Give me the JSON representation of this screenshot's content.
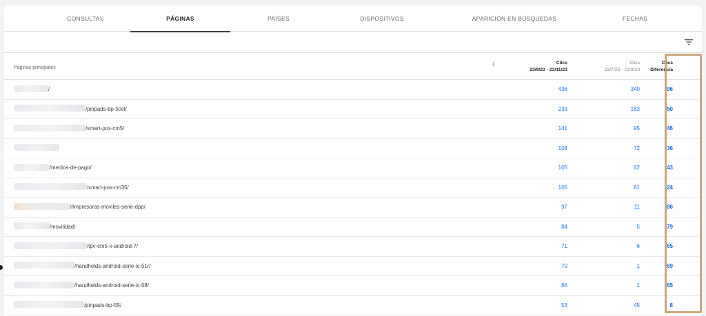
{
  "tabs": [
    {
      "label": "CONSULTAS"
    },
    {
      "label": "PÁGINAS"
    },
    {
      "label": "PAÍSES"
    },
    {
      "label": "DISPOSITIVOS"
    },
    {
      "label": "APARICIÓN EN BÚSQUEDAS"
    },
    {
      "label": "FECHAS"
    }
  ],
  "active_tab": "PÁGINAS",
  "table": {
    "page_header": "Páginas principales",
    "columns": [
      {
        "line1": "Clics",
        "line2": "23/9/23 - 23/11/23",
        "sort": "↓"
      },
      {
        "line1": "Clics",
        "line2": "23/7/23 - 22/9/23"
      },
      {
        "line1": "Clics",
        "line2": "Diferencia"
      }
    ],
    "rows": [
      {
        "path": "/",
        "c1": "436",
        "c2": "340",
        "diff": "96"
      },
      {
        "path": "/pinpads-bp-50cl/",
        "c1": "233",
        "c2": "183",
        "diff": "50"
      },
      {
        "path": "/smart-pos-cm5/",
        "c1": "141",
        "c2": "95",
        "diff": "46"
      },
      {
        "path": "",
        "c1": "108",
        "c2": "72",
        "diff": "36"
      },
      {
        "path": "/medios-de-pago/",
        "c1": "105",
        "c2": "62",
        "diff": "43"
      },
      {
        "path": "/smart-pos-cm35/",
        "c1": "105",
        "c2": "81",
        "diff": "24"
      },
      {
        "path": "l/impresoras-moviles-serie-dpp/",
        "c1": "97",
        "c2": "11",
        "diff": "86"
      },
      {
        "path": "/movilidad/",
        "c1": "84",
        "c2": "5",
        "diff": "79"
      },
      {
        "path": "/tpv-cm5-x-android-7/",
        "c1": "71",
        "c2": "6",
        "diff": "65"
      },
      {
        "path": "/handhelds-android-serie-ic-51r/",
        "c1": "70",
        "c2": "1",
        "diff": "69"
      },
      {
        "path": "/handhelds-android-serie-ic-58/",
        "c1": "66",
        "c2": "1",
        "diff": "65"
      },
      {
        "path": "/pinpads-bp-55/",
        "c1": "53",
        "c2": "45",
        "diff": "8"
      }
    ]
  },
  "colors": {
    "link_blue": "#1a73e8",
    "highlight_border": "#c9a67d",
    "active_tab_underline": "#3c4043"
  },
  "icons": {
    "filter": "filter-list-icon",
    "sort": "arrow-down-icon"
  }
}
